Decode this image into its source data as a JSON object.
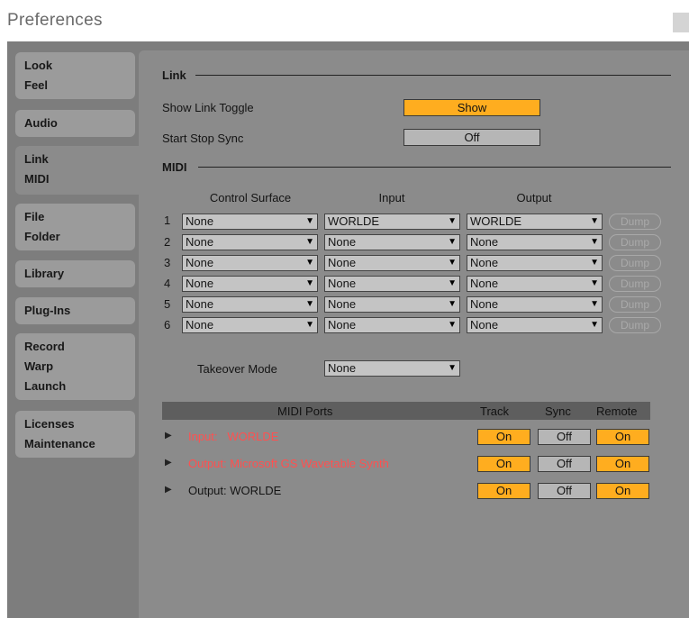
{
  "window": {
    "title": "Preferences"
  },
  "sidebar": {
    "tabs": [
      {
        "line1": "Look",
        "line2": "Feel"
      },
      {
        "line1": "Audio",
        "line2": ""
      },
      {
        "line1": "Link",
        "line2": "MIDI"
      },
      {
        "line1": "File",
        "line2": "Folder"
      },
      {
        "line1": "Library",
        "line2": ""
      },
      {
        "line1": "Plug-Ins",
        "line2": ""
      },
      {
        "line1": "Record",
        "line2": "Warp",
        "line3": "Launch"
      },
      {
        "line1": "Licenses",
        "line2": "Maintenance"
      }
    ],
    "active_tab": "Link MIDI"
  },
  "link": {
    "section_label": "Link",
    "show_toggle_label": "Show Link Toggle",
    "show_toggle_value": "Show",
    "start_stop_label": "Start Stop Sync",
    "start_stop_value": "Off"
  },
  "midi": {
    "section_label": "MIDI",
    "col_control_surface": "Control Surface",
    "col_input": "Input",
    "col_output": "Output",
    "dump_label": "Dump",
    "rows": [
      {
        "num": "1",
        "surface": "None",
        "input": "WORLDE",
        "output": "WORLDE"
      },
      {
        "num": "2",
        "surface": "None",
        "input": "None",
        "output": "None"
      },
      {
        "num": "3",
        "surface": "None",
        "input": "None",
        "output": "None"
      },
      {
        "num": "4",
        "surface": "None",
        "input": "None",
        "output": "None"
      },
      {
        "num": "5",
        "surface": "None",
        "input": "None",
        "output": "None"
      },
      {
        "num": "6",
        "surface": "None",
        "input": "None",
        "output": "None"
      }
    ],
    "takeover_label": "Takeover Mode",
    "takeover_value": "None"
  },
  "ports": {
    "header": {
      "ports": "MIDI Ports",
      "track": "Track",
      "sync": "Sync",
      "remote": "Remote"
    },
    "rows": [
      {
        "label": "Input:",
        "device": "WORLDE",
        "track": "On",
        "sync": "Off",
        "remote": "On"
      },
      {
        "label": "Output:",
        "device": "Microsoft GS Wavetable Synth",
        "track": "On",
        "sync": "Off",
        "remote": "On"
      },
      {
        "label": "Output:",
        "device": "WORLDE",
        "track": "On",
        "sync": "Off",
        "remote": "On"
      }
    ]
  },
  "colors": {
    "accent_on": "#ffad1f",
    "off_button": "#b6b6b6",
    "panel": "#8b8b8b",
    "sidebar": "#7d7d7d",
    "port_error_text": "#ff5050"
  }
}
